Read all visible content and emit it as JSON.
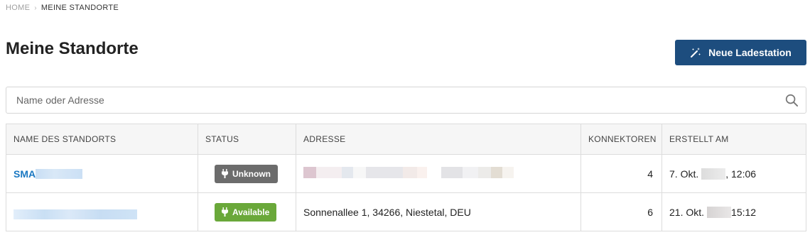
{
  "breadcrumb": {
    "home": "HOME",
    "current": "MEINE STANDORTE"
  },
  "page_title": "Meine Standorte",
  "new_station_button": {
    "label": "Neue Ladestation",
    "icon": "magic-wand-icon"
  },
  "search": {
    "placeholder": "Name oder Adresse",
    "value": "",
    "icon": "search-icon"
  },
  "table": {
    "columns": [
      "NAME DES STANDORTS",
      "STATUS",
      "ADRESSE",
      "KONNEKTOREN",
      "ERSTELLT AM"
    ],
    "rows": [
      {
        "name_visible": "SMA",
        "status": "Unknown",
        "status_color": "#6c6c6c",
        "address": "",
        "connectors": "4",
        "created_prefix": "7. Okt.",
        "created_suffix": ", 12:06"
      },
      {
        "name_visible": "",
        "status": "Available",
        "status_color": "#6aa83a",
        "address": "Sonnenallee 1, 34266, Niestetal, DEU",
        "connectors": "6",
        "created_prefix": "21. Okt.",
        "created_suffix": " 15:12"
      }
    ]
  },
  "colors": {
    "primary": "#1d4d7e",
    "link": "#1a78c2",
    "status_unknown": "#6c6c6c",
    "status_available": "#6aa83a"
  }
}
